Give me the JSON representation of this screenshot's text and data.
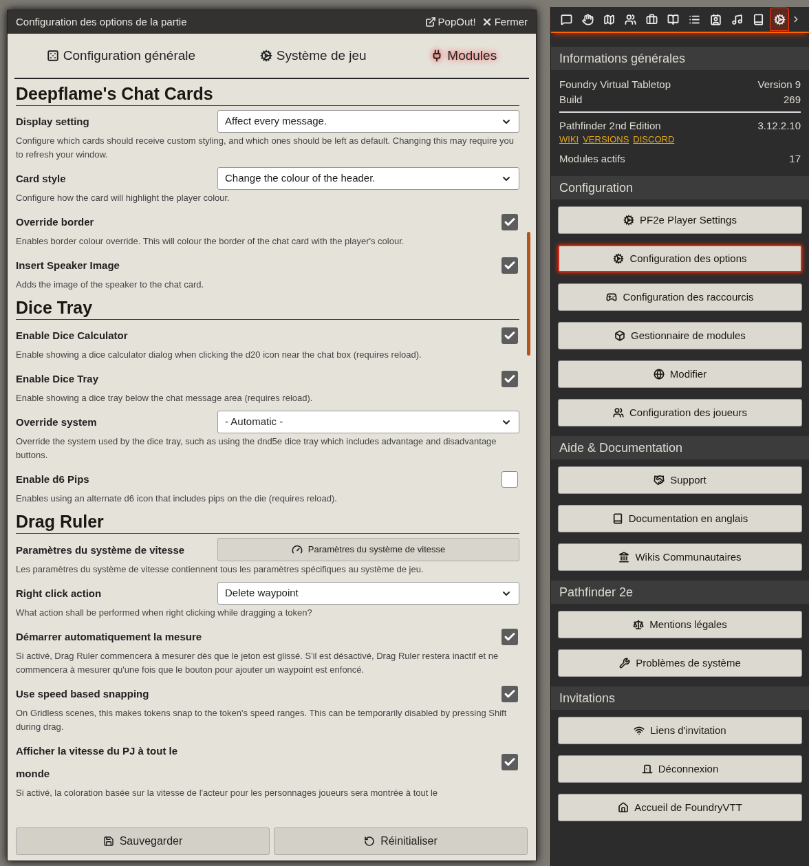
{
  "window": {
    "title": "Configuration des options de la partie",
    "actions": [
      {
        "kind": "popout",
        "label": "PopOut!"
      },
      {
        "kind": "close",
        "label": "Fermer"
      }
    ]
  },
  "tabs": [
    {
      "kind": "core",
      "label": "Configuration générale",
      "selected": false
    },
    {
      "kind": "system",
      "label": "Système de jeu",
      "selected": false
    },
    {
      "kind": "modules",
      "label": "Modules",
      "selected": true
    }
  ],
  "sections": [
    {
      "title": "Deepflame's Chat Cards",
      "settings": [
        {
          "kind": "select",
          "label": "Display setting",
          "value": "Affect every message.",
          "hint": "Configure which cards should receive custom styling, and which ones should be left as default. Changing this may require you to refresh your window."
        },
        {
          "kind": "select",
          "label": "Card style",
          "value": "Change the colour of the header.",
          "hint": "Configure how the card will highlight the player colour."
        },
        {
          "kind": "checkbox",
          "label": "Override border",
          "checked": true,
          "hint": "Enables border colour override. This will colour the border of the chat card with the player's colour."
        },
        {
          "kind": "checkbox",
          "label": "Insert Speaker Image",
          "checked": true,
          "hint": "Adds the image of the speaker to the chat card."
        }
      ]
    },
    {
      "title": "Dice Tray",
      "settings": [
        {
          "kind": "checkbox",
          "label": "Enable Dice Calculator",
          "checked": true,
          "hint": "Enable showing a dice calculator dialog when clicking the d20 icon near the chat box (requires reload)."
        },
        {
          "kind": "checkbox",
          "label": "Enable Dice Tray",
          "checked": true,
          "hint": "Enable showing a dice tray below the chat message area (requires reload)."
        },
        {
          "kind": "select",
          "label": "Override system",
          "value": "- Automatic -",
          "hint": "Override the system used by the dice tray, such as using the dnd5e dice tray which includes advantage and disadvantage buttons."
        },
        {
          "kind": "checkbox",
          "label": "Enable d6 Pips",
          "checked": false,
          "hint": "Enables using an alternate d6 icon that includes pips on the die (requires reload)."
        }
      ]
    },
    {
      "title": "Drag Ruler",
      "settings": [
        {
          "kind": "button",
          "label": "Paramètres du système de vitesse",
          "button": "Paramètres du système de vitesse",
          "hint": "Les paramètres du système de vitesse contiennent tous les paramètres spécifiques au système de jeu."
        },
        {
          "kind": "select",
          "label": "Right click action",
          "value": "Delete waypoint",
          "hint": "What action shall be performed when right clicking while dragging a token?"
        },
        {
          "kind": "checkbox",
          "label": "Démarrer automatiquement la mesure",
          "checked": true,
          "hint": "Si activé, Drag Ruler commencera à mesurer dès que le jeton est glissé. S'il est désactivé, Drag Ruler restera inactif et ne commencera à mesurer qu'une fois que le bouton pour ajouter un waypoint est enfoncé."
        },
        {
          "kind": "checkbox",
          "label": "Use speed based snapping",
          "checked": true,
          "hint": "On Gridless scenes, this makes tokens snap to the token's speed ranges. This can be temporarily disabled by pressing Shift during drag."
        },
        {
          "kind": "checkbox",
          "label": "Afficher la vitesse du PJ à tout le monde",
          "checked": true,
          "hint": "Si activé, la coloration basée sur la vitesse de l'acteur pour les personnages joueurs sera montrée à tout le"
        }
      ]
    }
  ],
  "footer_buttons": [
    {
      "kind": "save",
      "label": "Sauvegarder"
    },
    {
      "kind": "reset",
      "label": "Réinitialiser"
    }
  ],
  "sidebar": {
    "tabs": [
      {
        "kind": "chat",
        "selected": false
      },
      {
        "kind": "combat",
        "selected": false
      },
      {
        "kind": "scenes",
        "selected": false
      },
      {
        "kind": "actors",
        "selected": false
      },
      {
        "kind": "items",
        "selected": false
      },
      {
        "kind": "journal",
        "selected": false
      },
      {
        "kind": "tables",
        "selected": false
      },
      {
        "kind": "cards",
        "selected": false
      },
      {
        "kind": "playlists",
        "selected": false
      },
      {
        "kind": "compendium",
        "selected": false
      },
      {
        "kind": "settings",
        "selected": true
      }
    ],
    "info": {
      "title": "Informations générales",
      "core": [
        {
          "label": "Foundry Virtual Tabletop",
          "value": "Version 9"
        },
        {
          "label": "Build",
          "value": "269"
        }
      ],
      "system": {
        "label": "Pathfinder 2nd Edition",
        "value": "3.12.2.10",
        "links": [
          "WIKI",
          "VERSIONS",
          "DISCORD"
        ]
      },
      "modules": {
        "label": "Modules actifs",
        "value": "17"
      }
    },
    "groups": [
      {
        "title": "Configuration",
        "buttons": [
          {
            "kind": "cogs",
            "label": "PF2e Player Settings",
            "selected": false
          },
          {
            "kind": "cogs",
            "label": "Configuration des options",
            "selected": true
          },
          {
            "kind": "gamepad",
            "label": "Configuration des raccourcis",
            "selected": false
          },
          {
            "kind": "cube",
            "label": "Gestionnaire de modules",
            "selected": false
          },
          {
            "kind": "globe",
            "label": "Modifier",
            "selected": false
          },
          {
            "kind": "users",
            "label": "Configuration des joueurs",
            "selected": false
          }
        ]
      },
      {
        "title": "Aide & Documentation",
        "buttons": [
          {
            "kind": "handshake",
            "label": "Support",
            "selected": false
          },
          {
            "kind": "book",
            "label": "Documentation en anglais",
            "selected": false
          },
          {
            "kind": "landmark",
            "label": "Wikis Communautaires",
            "selected": false
          }
        ]
      },
      {
        "title": "Pathfinder 2e",
        "buttons": [
          {
            "kind": "scale",
            "label": "Mentions légales",
            "selected": false
          },
          {
            "kind": "wrench",
            "label": "Problèmes de système",
            "selected": false
          }
        ]
      },
      {
        "title": "Invitations",
        "buttons": [
          {
            "kind": "wifi",
            "label": "Liens d'invitation",
            "selected": false
          },
          {
            "kind": "door",
            "label": "Déconnexion",
            "selected": false
          },
          {
            "kind": "home",
            "label": "Accueil de FoundryVTT",
            "selected": false
          }
        ]
      }
    ]
  }
}
